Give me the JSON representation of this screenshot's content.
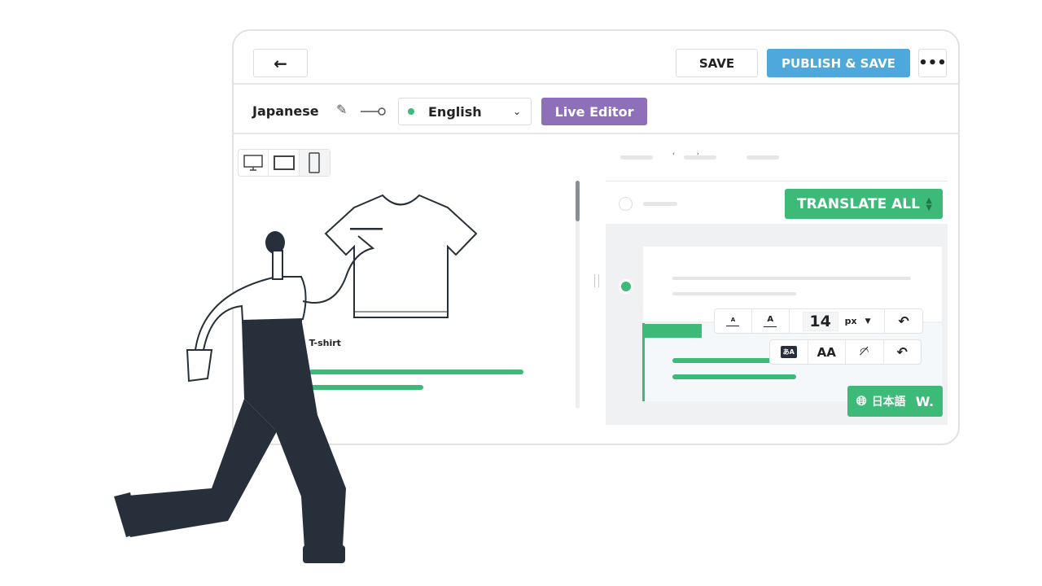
{
  "header": {
    "back_icon": "arrow-left-icon",
    "save_label": "SAVE",
    "publish_label": "PUBLISH & SAVE",
    "more_icon": "more-horizontal-icon"
  },
  "language_bar": {
    "source_language": "Japanese",
    "edit_icon": "pencil-icon",
    "target_language": "English",
    "live_editor_label": "Live Editor"
  },
  "preview": {
    "devices": [
      "desktop-icon",
      "tablet-icon",
      "mobile-icon"
    ],
    "selected_device": "mobile",
    "product_caption": "n T-shirt"
  },
  "translation_panel": {
    "translate_all_label": "TRANSLATE ALL",
    "font_size_value": "14",
    "font_size_unit": "px",
    "language_badge": "日本語",
    "brand_mark": "W."
  },
  "colors": {
    "accent_green": "#3dba78",
    "publish_blue": "#4fa8dc",
    "live_editor_purple": "#8e6fba",
    "dark": "#27303a"
  }
}
